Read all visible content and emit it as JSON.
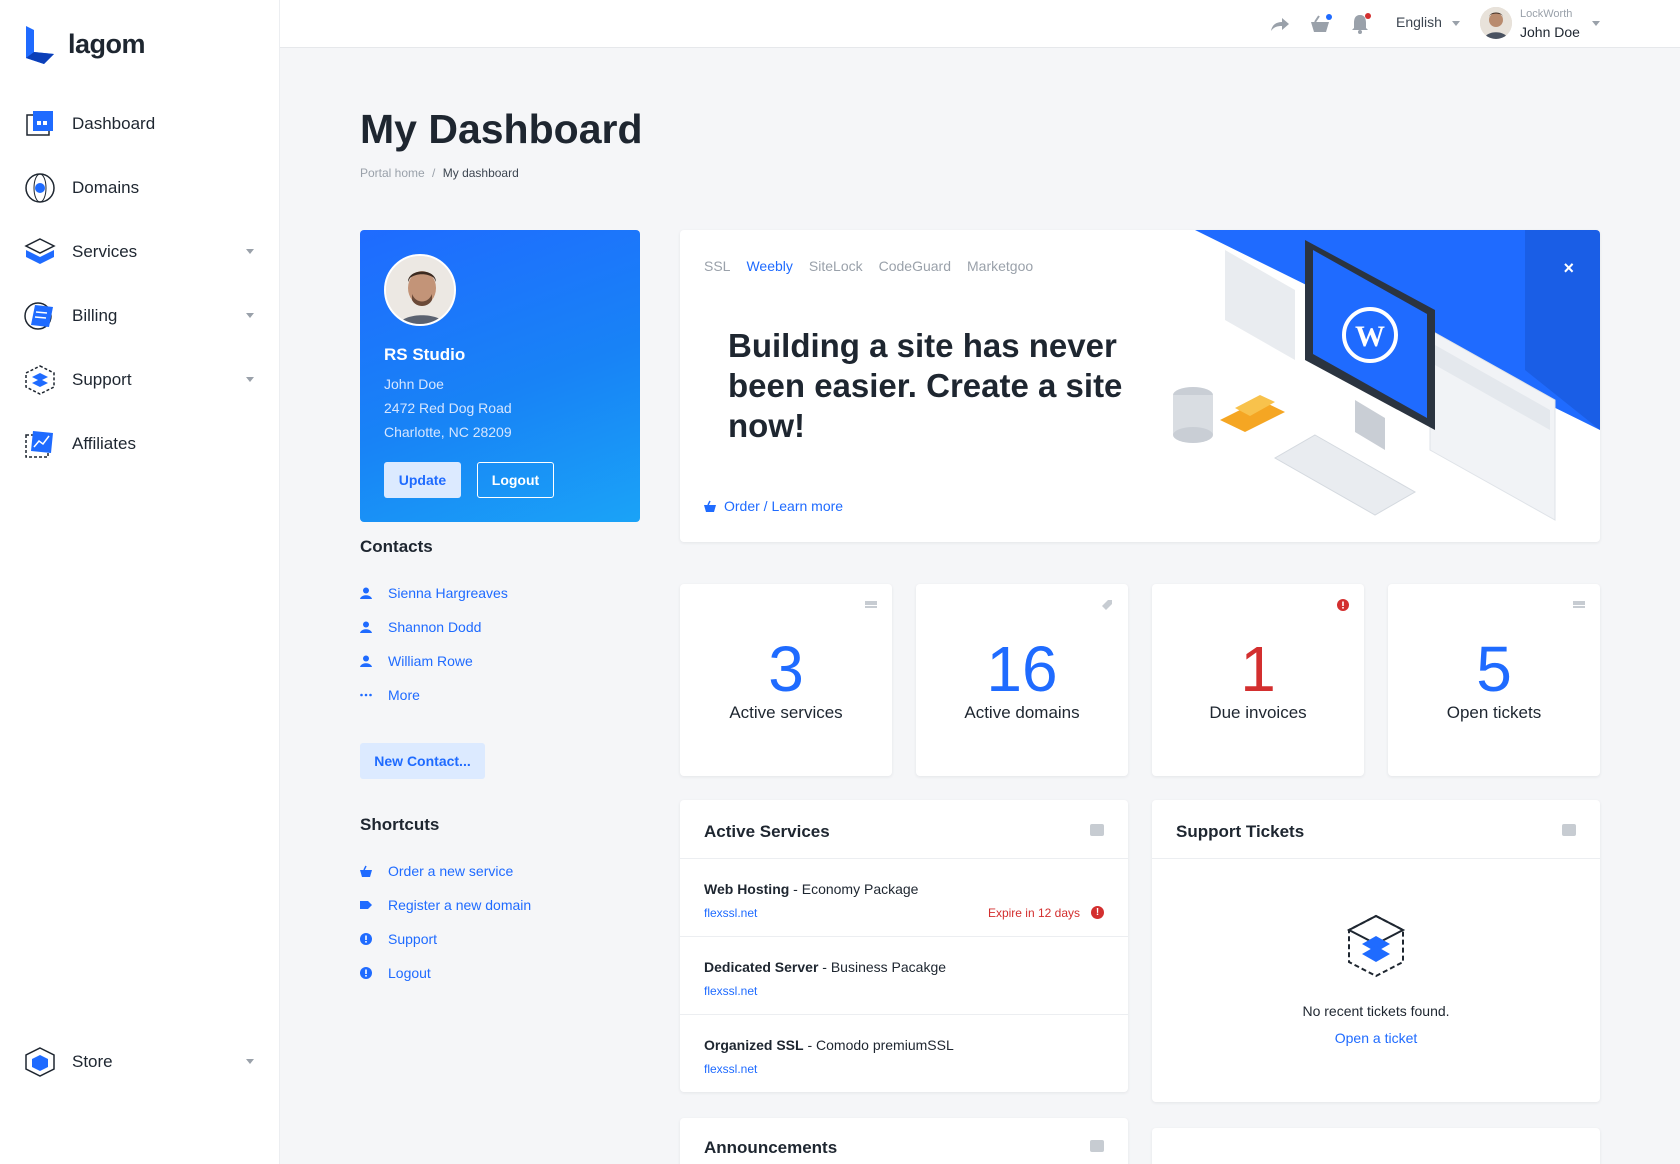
{
  "brand": {
    "name": "lagom",
    "accent": "#1f6bff",
    "danger": "#d32f2f"
  },
  "sidebar": {
    "items": [
      {
        "label": "Dashboard",
        "icon": "dashboard-icon",
        "has_caret": false
      },
      {
        "label": "Domains",
        "icon": "domains-icon",
        "has_caret": false
      },
      {
        "label": "Services",
        "icon": "services-icon",
        "has_caret": true
      },
      {
        "label": "Billing",
        "icon": "billing-icon",
        "has_caret": true
      },
      {
        "label": "Support",
        "icon": "support-icon",
        "has_caret": true
      },
      {
        "label": "Affiliates",
        "icon": "affiliates-icon",
        "has_caret": false
      }
    ],
    "store": {
      "label": "Store",
      "icon": "store-icon"
    }
  },
  "topbar": {
    "language": "English",
    "company": "LockWorth",
    "user": "John Doe"
  },
  "page": {
    "title": "My Dashboard",
    "breadcrumb": {
      "home": "Portal home",
      "sep": "/",
      "current": "My dashboard"
    }
  },
  "profile": {
    "company": "RS Studio",
    "name": "John Doe",
    "address1": "2472 Red Dog Road",
    "address2": "Charlotte, NC 28209",
    "update_label": "Update",
    "logout_label": "Logout"
  },
  "contacts": {
    "title": "Contacts",
    "items": [
      "Sienna Hargreaves",
      "Shannon Dodd",
      "William Rowe"
    ],
    "more_label": "More",
    "new_contact_label": "New Contact..."
  },
  "shortcuts": {
    "title": "Shortcuts",
    "items": [
      "Order a new service",
      "Register a new domain",
      "Support",
      "Logout"
    ]
  },
  "promo": {
    "tabs": [
      "SSL",
      "Weebly",
      "SiteLock",
      "CodeGuard",
      "Marketgoo"
    ],
    "active_tab": "Weebly",
    "headline": "Building a site has never been easier. Create a site now!",
    "link_label": "Order / Learn more",
    "close_label": "×"
  },
  "stats": [
    {
      "value": "3",
      "label": "Active services",
      "color": "#1f6bff"
    },
    {
      "value": "16",
      "label": "Active domains",
      "color": "#1f6bff"
    },
    {
      "value": "1",
      "label": "Due invoices",
      "color": "#d32f2f"
    },
    {
      "value": "5",
      "label": "Open tickets",
      "color": "#1f6bff"
    }
  ],
  "active_services": {
    "title": "Active Services",
    "rows": [
      {
        "name": "Web Hosting",
        "plan": " - Economy Package",
        "url": "flexssl.net",
        "expire": "Expire in 12 days"
      },
      {
        "name": "Dedicated Server",
        "plan": " - Business Pacakge",
        "url": "flexssl.net",
        "expire": ""
      },
      {
        "name": "Organized SSL",
        "plan": " - Comodo premiumSSL",
        "url": "flexssl.net",
        "expire": ""
      }
    ]
  },
  "support_tickets": {
    "title": "Support Tickets",
    "empty_text": "No recent tickets found.",
    "open_ticket_label": "Open a ticket"
  },
  "announcements": {
    "title": "Announcements"
  }
}
